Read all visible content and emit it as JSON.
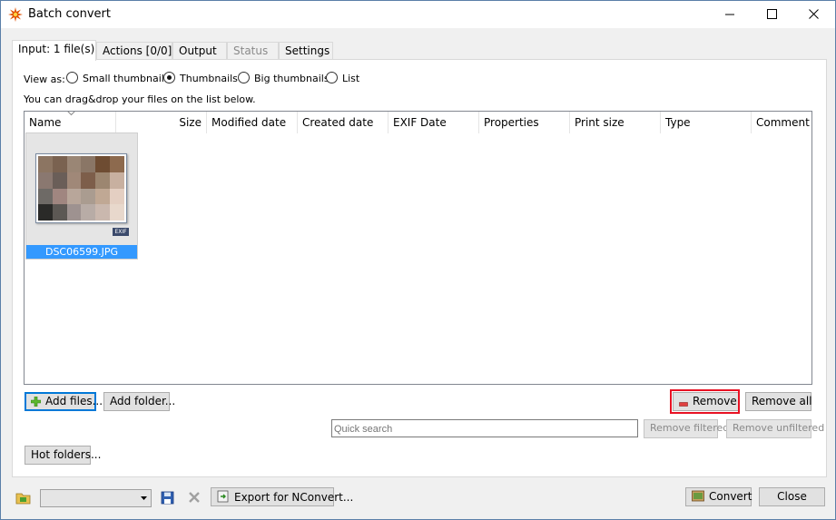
{
  "window": {
    "title": "Batch convert",
    "icon": "xnview-star-icon"
  },
  "tabs": [
    {
      "label": "Input: 1 file(s)",
      "active": true
    },
    {
      "label": "Actions [0/0]"
    },
    {
      "label": "Output"
    },
    {
      "label": "Status",
      "disabled": true
    },
    {
      "label": "Settings"
    }
  ],
  "view": {
    "label": "View as:",
    "options": [
      "Small thumbnails",
      "Thumbnails",
      "Big thumbnails",
      "List"
    ],
    "selected": "Thumbnails",
    "hint": "You can drag&drop your files on the list below."
  },
  "list": {
    "columns": [
      "Name",
      "Size",
      "Modified date",
      "Created date",
      "EXIF Date",
      "Properties",
      "Print size",
      "Type",
      "Comment"
    ],
    "items": [
      {
        "name": "DSC06599.JPG",
        "badge": "EXIF"
      }
    ]
  },
  "buttons": {
    "add_files": "Add files...",
    "add_folder": "Add folder...",
    "remove": "Remove",
    "remove_all": "Remove all",
    "remove_filtered": "Remove filtered",
    "remove_unfiltered": "Remove unfiltered",
    "hot_folders": "Hot folders...",
    "export": "Export for NConvert...",
    "convert": "Convert",
    "close": "Close"
  },
  "search": {
    "placeholder": "Quick search"
  },
  "colors": {
    "selection": "#3399ff",
    "highlight": "#e81123",
    "focus": "#0078d7"
  }
}
